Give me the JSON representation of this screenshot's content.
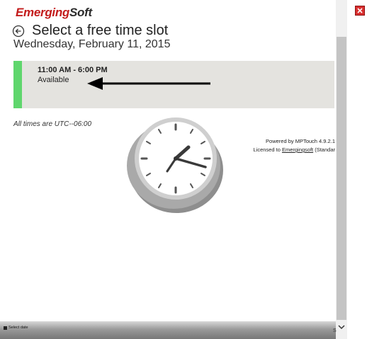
{
  "brand": {
    "part1": "Emerging",
    "part2": "Soft"
  },
  "header": {
    "title": "Select a free time slot",
    "date": "Wednesday, February 11, 2015"
  },
  "slot": {
    "time": "11:00 AM - 6:00 PM",
    "status": "Available",
    "accent_color": "#5fd66d"
  },
  "timezone_note": "All times are UTC--06:00",
  "footer": {
    "powered_by": "Powered by MPTouch 4.9.2.1",
    "licensed_prefix": "Licensed to ",
    "licensee": "Emergingsoft",
    "license_suffix": " (Standar"
  },
  "bottom_bar": {
    "select_date": "Select date",
    "corner": "S"
  },
  "icons": [
    "close-icon",
    "back-arrow-icon",
    "clock-icon",
    "pointer-arrow-icon",
    "chevron-down-icon"
  ]
}
